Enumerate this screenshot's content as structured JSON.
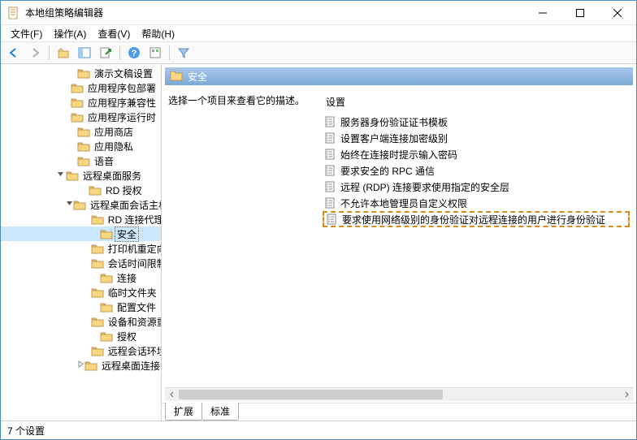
{
  "window": {
    "title": "本地组策略编辑器"
  },
  "menu": {
    "file": "文件(F)",
    "action": "操作(A)",
    "view": "查看(V)",
    "help": "帮助(H)"
  },
  "tree": {
    "items": [
      {
        "indent": 80,
        "label": "演示文稿设置",
        "twisty": ""
      },
      {
        "indent": 80,
        "label": "应用程序包部署",
        "twisty": ""
      },
      {
        "indent": 80,
        "label": "应用程序兼容性",
        "twisty": ""
      },
      {
        "indent": 80,
        "label": "应用程序运行时",
        "twisty": ""
      },
      {
        "indent": 80,
        "label": "应用商店",
        "twisty": ""
      },
      {
        "indent": 80,
        "label": "应用隐私",
        "twisty": ""
      },
      {
        "indent": 80,
        "label": "语音",
        "twisty": ""
      },
      {
        "indent": 66,
        "label": "远程桌面服务",
        "twisty": "v"
      },
      {
        "indent": 94,
        "label": "RD 授权",
        "twisty": ""
      },
      {
        "indent": 80,
        "label": "远程桌面会话主机",
        "twisty": "v"
      },
      {
        "indent": 108,
        "label": "RD 连接代理",
        "twisty": ""
      },
      {
        "indent": 108,
        "label": "安全",
        "twisty": "",
        "selected": true
      },
      {
        "indent": 108,
        "label": "打印机重定向",
        "twisty": ""
      },
      {
        "indent": 108,
        "label": "会话时间限制",
        "twisty": ""
      },
      {
        "indent": 108,
        "label": "连接",
        "twisty": ""
      },
      {
        "indent": 108,
        "label": "临时文件夹",
        "twisty": ""
      },
      {
        "indent": 108,
        "label": "配置文件",
        "twisty": ""
      },
      {
        "indent": 108,
        "label": "设备和资源重定向",
        "twisty": ""
      },
      {
        "indent": 108,
        "label": "授权",
        "twisty": ""
      },
      {
        "indent": 108,
        "label": "远程会话环境",
        "twisty": ""
      },
      {
        "indent": 94,
        "label": "远程桌面连接客户端",
        "twisty": ">"
      }
    ]
  },
  "details": {
    "header": "安全",
    "description": "选择一个项目来查看它的描述。",
    "col_settings": "设置",
    "settings": [
      {
        "label": "服务器身份验证证书模板"
      },
      {
        "label": "设置客户端连接加密级别"
      },
      {
        "label": "始终在连接时提示输入密码"
      },
      {
        "label": "要求安全的 RPC 通信"
      },
      {
        "label": "远程 (RDP) 连接要求使用指定的安全层"
      },
      {
        "label": "不允许本地管理员自定义权限"
      },
      {
        "label": "要求使用网络级别的身份验证对远程连接的用户进行身份验证",
        "highlight": true
      }
    ]
  },
  "tabs": {
    "extended": "扩展",
    "standard": "标准"
  },
  "status": "7 个设置"
}
